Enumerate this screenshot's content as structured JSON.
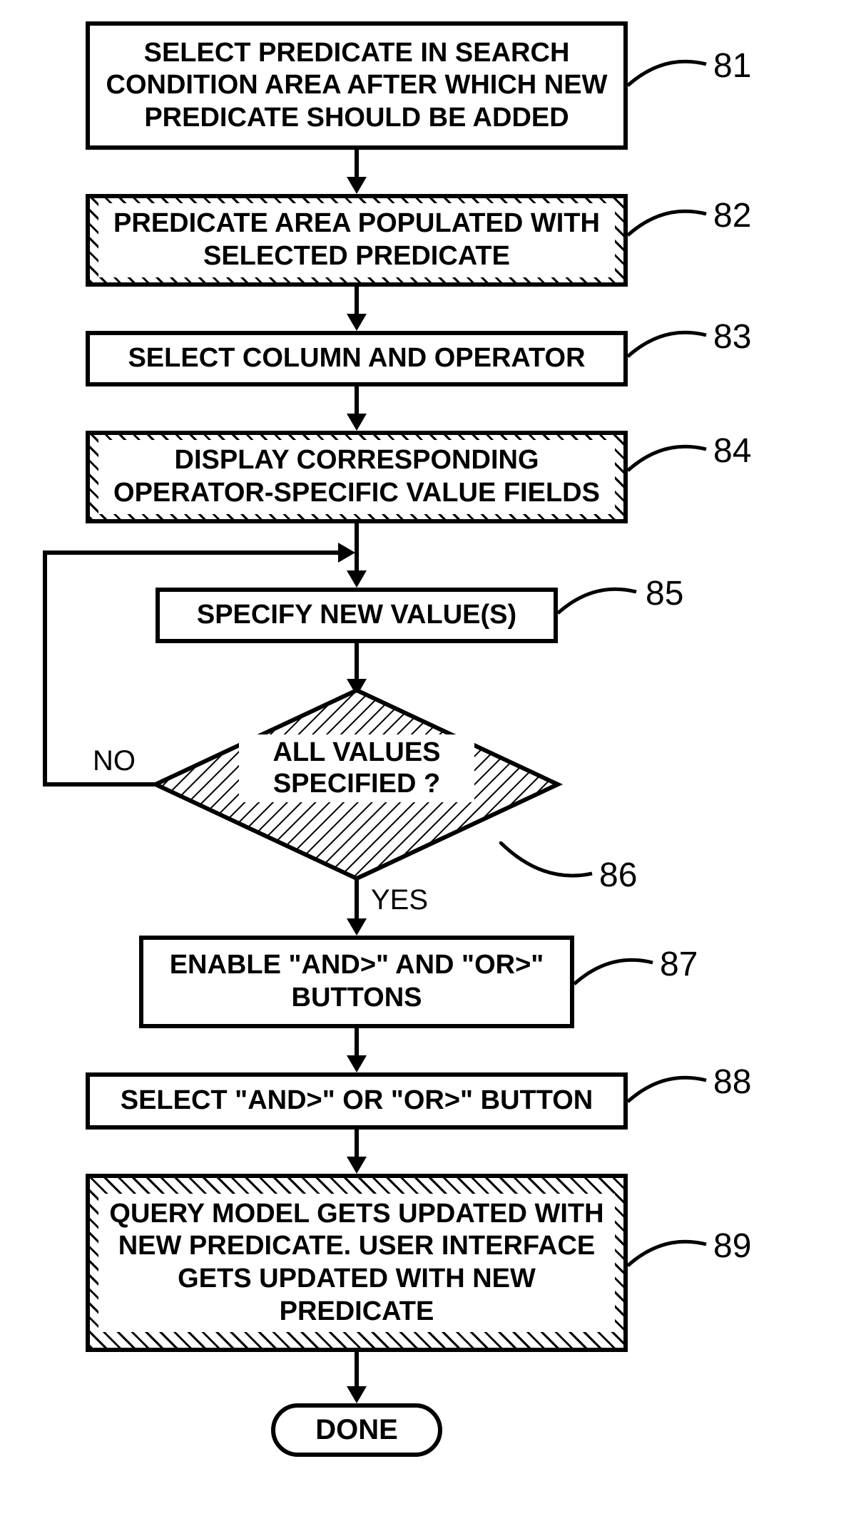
{
  "steps": {
    "s81": {
      "text": "SELECT PREDICATE IN SEARCH CONDITION AREA AFTER WHICH NEW PREDICATE SHOULD BE ADDED",
      "ref": "81"
    },
    "s82": {
      "text": "PREDICATE AREA POPULATED WITH SELECTED PREDICATE",
      "ref": "82"
    },
    "s83": {
      "text": "SELECT COLUMN AND OPERATOR",
      "ref": "83"
    },
    "s84": {
      "text": "DISPLAY CORRESPONDING OPERATOR-SPECIFIC VALUE FIELDS",
      "ref": "84"
    },
    "s85": {
      "text": "SPECIFY NEW VALUE(S)",
      "ref": "85"
    },
    "s86": {
      "text": "ALL VALUES SPECIFIED ?",
      "ref": "86",
      "no": "NO",
      "yes": "YES"
    },
    "s87": {
      "text": "ENABLE \"AND>\" AND \"OR>\" BUTTONS",
      "ref": "87"
    },
    "s88": {
      "text": "SELECT \"AND>\" OR \"OR>\" BUTTON",
      "ref": "88"
    },
    "s89": {
      "text": "QUERY MODEL GETS UPDATED WITH NEW PREDICATE. USER INTERFACE GETS UPDATED WITH NEW PREDICATE",
      "ref": "89"
    },
    "done": {
      "text": "DONE"
    }
  }
}
